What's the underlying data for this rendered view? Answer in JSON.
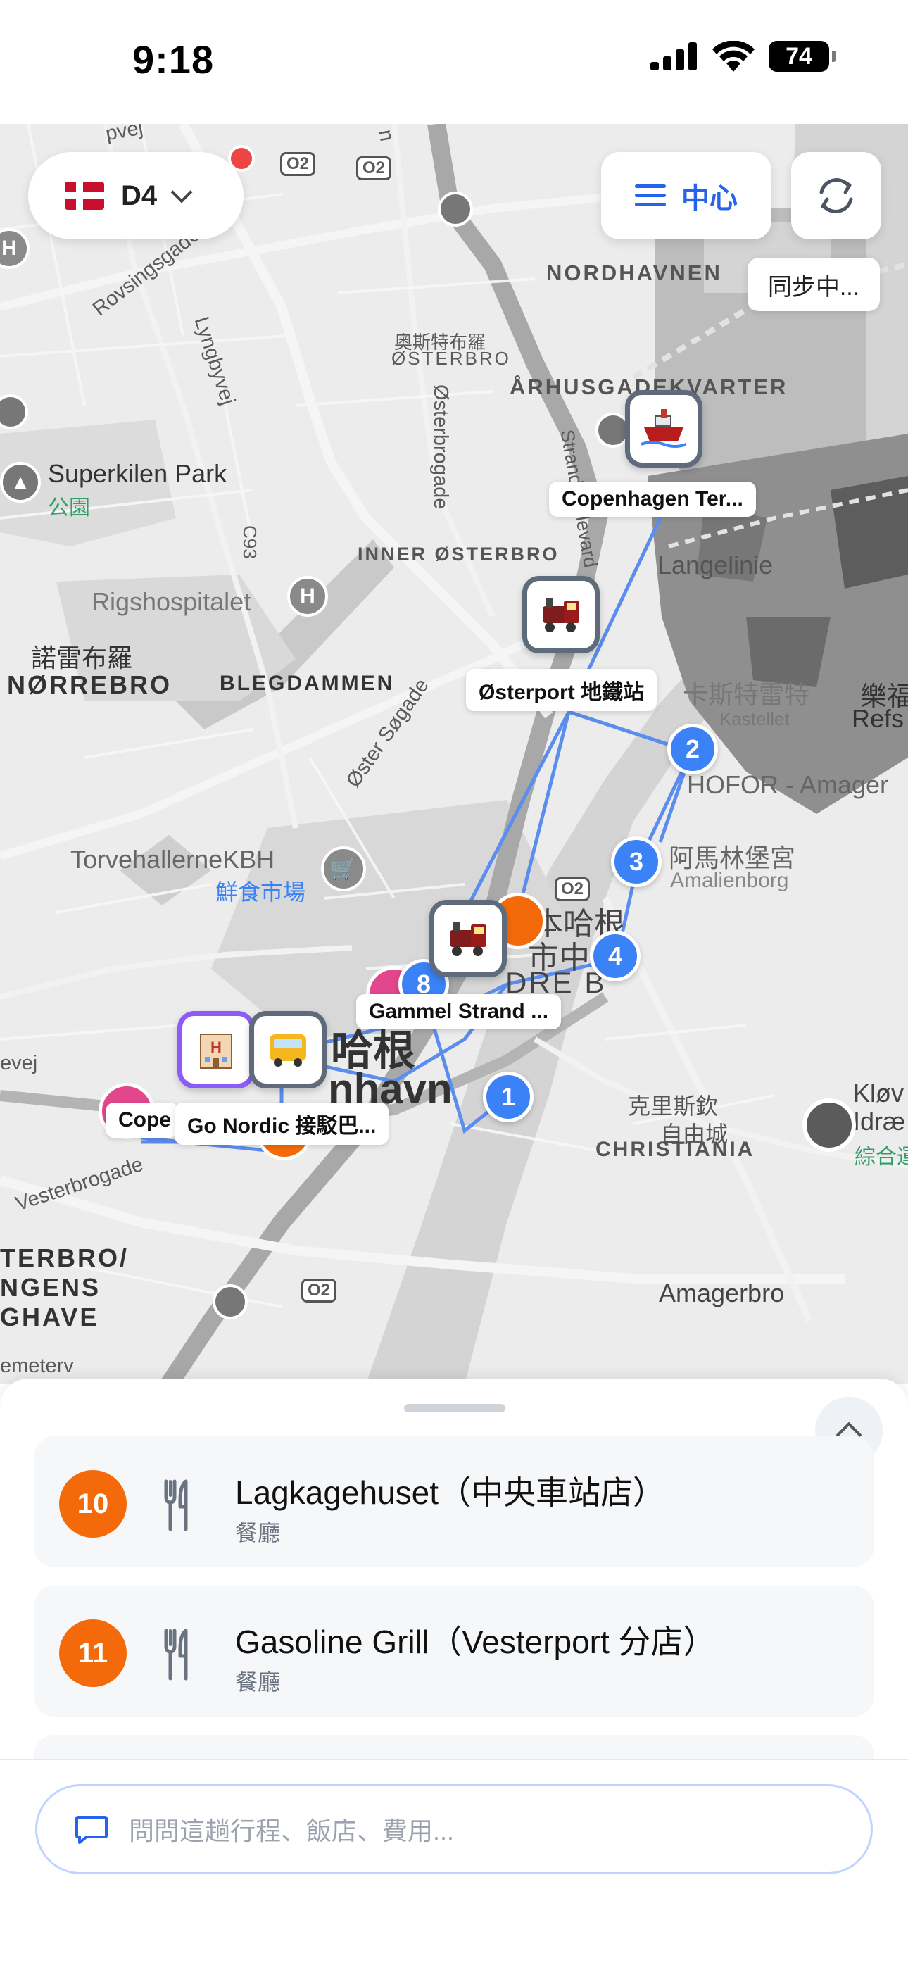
{
  "status_bar": {
    "time": "9:18",
    "battery": "74",
    "battery_level": 0.74
  },
  "controls": {
    "trip_day": "D4",
    "center_label": "中心",
    "sync_status": "同步中..."
  },
  "map": {
    "districts": [
      "NORDHAVNEN",
      "ÅRHUSGADEKVARTER",
      "INNER ØSTERBRO",
      "BLEGDAMMEN",
      "NØRREBRO",
      "CHRISTIANIA",
      "ØSTERBRO",
      "TERBRO/",
      "NGENS",
      "GHAVE"
    ],
    "chinese_labels": {
      "osterbro": "奧斯特布羅",
      "norrebro": "諾雷布羅",
      "christiania_1": "克里斯欽",
      "christiania_2": "自由城",
      "amalienborg": "阿馬林堡宮",
      "kastellet": "卡斯特雷特",
      "center_1": "本哈根",
      "center_2": "市中心",
      "copenhavn_big": "哈根",
      "refs_cn": "樂福",
      "klov_cn": "綜合運"
    },
    "streets": [
      "Rovsingsgade",
      "Lyngbyvej",
      "Østerbrogade",
      "Strandboulevard",
      "Øster Søgade",
      "Vesterbrogade",
      "C93",
      "O2",
      "O2",
      "O2",
      "O2",
      "O2",
      "pvej",
      "evej",
      "emeterv",
      "n"
    ],
    "places": {
      "superkilen": "Superkilen Park",
      "superkilen_type": "公園",
      "rigshospitalet": "Rigshospitalet",
      "langelinie": "Langelinie",
      "torvehallerne": "TorvehallerneKBH",
      "torvehallerne_type": "鮮食市場",
      "hofor": "HOFOR - Amager",
      "amalienborg": "Amalienborg",
      "kastellet": "Kastellet",
      "amagerbro": "Amagerbro",
      "refs": "Refs",
      "klov": "Kløv",
      "idrae": "Idræ",
      "kobenhavn_part": "nhavn",
      "indre_by_part": "DRE B"
    },
    "pins": {
      "cruise_terminal": "Copenhagen Ter...",
      "osterport": "Østerport 地鐵站",
      "gammel_strand": "Gammel Strand ...",
      "hotel_label": "Cope",
      "bus_label": "Go Nordic 接駁巴..."
    },
    "numbered_stops": [
      "1",
      "2",
      "3",
      "4",
      "8"
    ]
  },
  "itinerary": [
    {
      "number": "10",
      "title": "Lagkagehuset（中央車站店）",
      "category": "餐廳"
    },
    {
      "number": "11",
      "title": "Gasoline Grill（Vesterport 分店）",
      "category": "餐廳"
    }
  ],
  "chat": {
    "placeholder": "問問這趟行程、飯店、費用..."
  },
  "colors": {
    "accent": "#2563eb",
    "route": "#3b82f6",
    "stop_orange": "#f46a0a",
    "hotel_purple": "#8b5cf6",
    "alert": "#ef4444"
  }
}
